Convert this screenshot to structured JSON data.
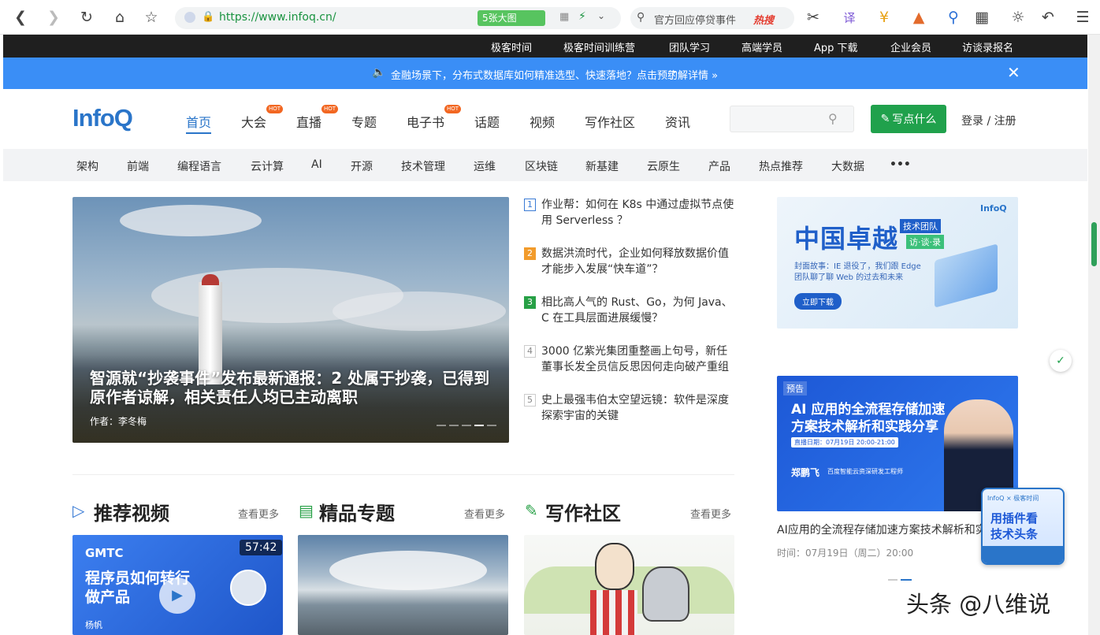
{
  "browser": {
    "url": "https://www.infoq.cn/",
    "big_pic_label": "5张大图",
    "search_text": "官方回应停贷事件",
    "hot_search": "热搜"
  },
  "topbar": {
    "links": [
      "极客时间",
      "极客时间训练营",
      "团队学习",
      "高端学员",
      "App 下载",
      "企业会员",
      "访谈录报名"
    ]
  },
  "announcement": {
    "text": "金融场景下，分布式数据库如何精准选型、快速落地？点击预约",
    "link": "了解详情 »"
  },
  "header": {
    "logo": "InfoQ",
    "nav": [
      {
        "label": "首页",
        "hot": ""
      },
      {
        "label": "大会",
        "hot": "HOT"
      },
      {
        "label": "直播",
        "hot": "HOT"
      },
      {
        "label": "专题",
        "hot": ""
      },
      {
        "label": "电子书",
        "hot": "HOT"
      },
      {
        "label": "话题",
        "hot": ""
      },
      {
        "label": "视频",
        "hot": ""
      },
      {
        "label": "写作社区",
        "hot": ""
      },
      {
        "label": "资讯",
        "hot": ""
      }
    ],
    "write_button": "写点什么",
    "login": "登录 / 注册"
  },
  "categories": [
    "架构",
    "前端",
    "编程语言",
    "云计算",
    "AI",
    "开源",
    "技术管理",
    "运维",
    "区块链",
    "新基建",
    "云原生",
    "产品",
    "热点推荐",
    "大数据",
    "•••"
  ],
  "hero": {
    "title": "智源就“抄袭事件”发布最新通报：2 处属于抄袭，已得到原作者谅解，相关责任人均已主动离职",
    "author": "作者：李冬梅"
  },
  "hot_list": [
    {
      "num": "1",
      "title": "作业帮：如何在 K8s 中通过虚拟节点使用 Serverless ？",
      "color": "#3a7bd5"
    },
    {
      "num": "2",
      "title": "数据洪流时代，企业如何释放数据价值才能步入发展“快车道”？",
      "color": "#f29b2b"
    },
    {
      "num": "3",
      "title": "相比高人气的 Rust、Go，为何 Java、C 在工具层面进展缓慢？",
      "color": "#27a046"
    },
    {
      "num": "4",
      "title": "3000 亿紫光集团重整画上句号，新任董事长发全员信反思因何走向破产重组",
      "color": "#999999"
    },
    {
      "num": "5",
      "title": "史上最强韦伯太空望远镜：软件是深度探索宇宙的关键",
      "color": "#999999"
    }
  ],
  "ad1": {
    "title": "中国卓越",
    "tag1": "技术团队",
    "tag2": "访·谈·录",
    "brand": "InfoQ",
    "desc": "封面故事：IE 退役了，我们跟 Edge 团队聊了聊 Web 的过去和未来",
    "cta": "立即下载"
  },
  "ad2": {
    "badge": "预告",
    "title": "AI 应用的全流程存储加速方案技术解析和实践分享",
    "time_tag": "直播日期：07月19日 20:00-21:00",
    "speaker": "郑鹏飞",
    "speaker_title": "百度智能云资深研发工程师"
  },
  "ad2_caption": "AI应用的全流程存储加速方案技术解析和实",
  "ad2_time": "时间：07月19日（周二）20:00",
  "plugin": {
    "top": "InfoQ × 极客时间",
    "line1": "用插件看",
    "line2": "技术头条"
  },
  "sections": [
    {
      "title": "推荐视频",
      "more": "查看更多"
    },
    {
      "title": "精品专题",
      "more": "查看更多"
    },
    {
      "title": "写作社区",
      "more": "查看更多"
    }
  ],
  "video": {
    "brand": "GMTC",
    "title1": "程序员如何转行",
    "title2": "做产品",
    "duration": "57:42",
    "speaker": "杨帆"
  },
  "watermark": "头条 @八维说"
}
